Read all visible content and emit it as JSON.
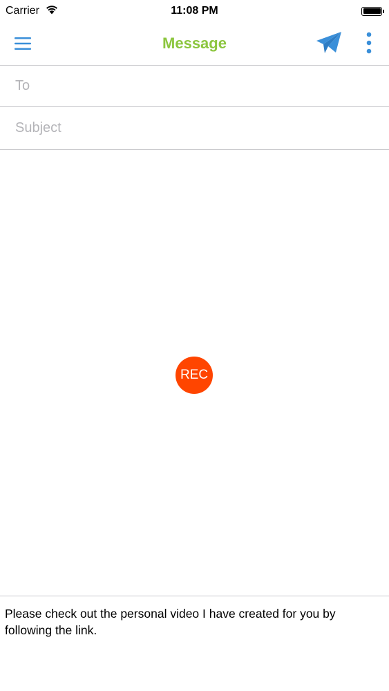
{
  "status_bar": {
    "carrier": "Carrier",
    "time": "11:08 PM",
    "battery_level": 1.0
  },
  "nav": {
    "title": "Message",
    "title_color": "#8cc63f",
    "accent_color": "#3a8fd9",
    "icons": {
      "menu": "hamburger-menu-icon",
      "send": "paper-plane-icon",
      "more": "vertical-ellipsis-icon"
    }
  },
  "compose": {
    "to": {
      "value": "",
      "placeholder": "To"
    },
    "subject": {
      "value": "",
      "placeholder": "Subject"
    }
  },
  "video": {
    "rec_label": "REC",
    "rec_color": "#ff4500"
  },
  "message": {
    "body": "Please check out the personal video I have created for you by following the link."
  }
}
